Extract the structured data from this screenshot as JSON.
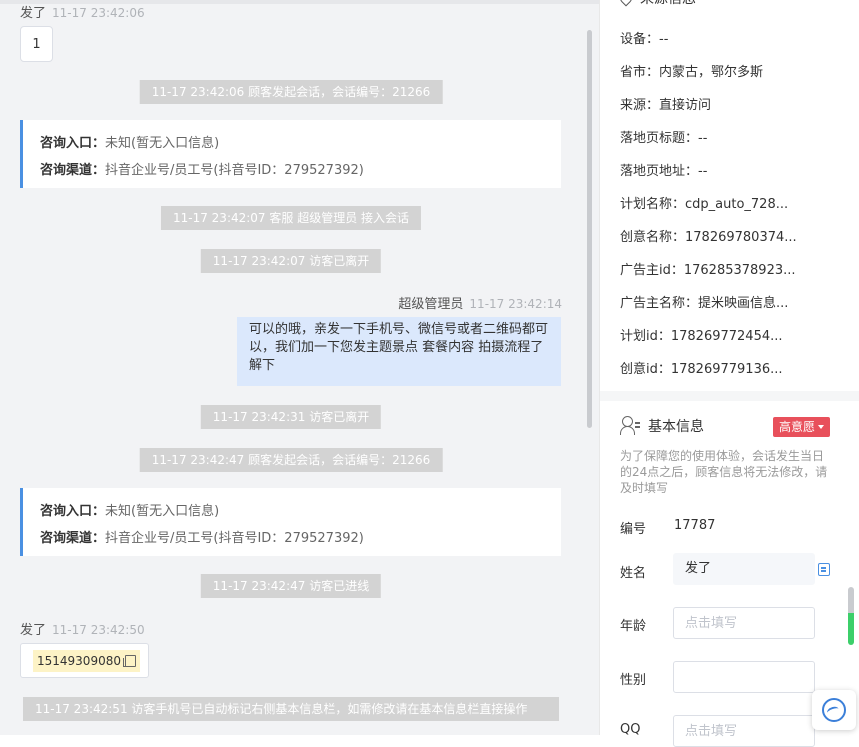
{
  "chat": {
    "top_sender": {
      "name": "发了",
      "time": "11-17 23:42:06"
    },
    "top_bubble": "1",
    "sys1": "11-17 23:42:06 顾客发起会话，会话编号：21266",
    "card1": {
      "entry_label": "咨询入口：",
      "entry_value": "未知(暂无入口信息)",
      "channel_label": "咨询渠道：",
      "channel_value": "抖音企业号/员工号(抖音号ID：279527392)"
    },
    "sys2": "11-17 23:42:07 客服 超级管理员 接入会话",
    "sys3": "11-17 23:42:07 访客已离开",
    "agent_sender": {
      "name": "超级管理员",
      "time": "11-17 23:42:14"
    },
    "agent_message": "可以的哦，亲发一下手机号、微信号或者二维码都可以，我们加一下您发主题景点 套餐内容 拍摄流程了解下",
    "sys4": "11-17 23:42:31 访客已离开",
    "sys5": "11-17 23:42:47 顾客发起会话，会话编号：21266",
    "card2": {
      "entry_label": "咨询入口：",
      "entry_value": "未知(暂无入口信息)",
      "channel_label": "咨询渠道：",
      "channel_value": "抖音企业号/员工号(抖音号ID：279527392)"
    },
    "sys6": "11-17 23:42:47 访客已进线",
    "visitor_sender": {
      "name": "发了",
      "time": "11-17 23:42:50"
    },
    "phone": "15149309080",
    "sys7": "11-17 23:42:51 访客手机号已自动标记右侧基本信息栏，如需修改请在基本信息栏直接操作"
  },
  "source": {
    "title": "来源信息",
    "rows": [
      "设备：--",
      "省市：内蒙古，鄂尔多斯",
      "来源：直接访问",
      "落地页标题：--",
      "落地页地址：--",
      "计划名称：cdp_auto_728...",
      "创意名称：178269780374...",
      "广告主id：176285378923...",
      "广告主名称：提米映画信息...",
      "计划id：178269772454...",
      "创意id：178269779136..."
    ]
  },
  "basic": {
    "title": "基本信息",
    "intent": "高意愿",
    "notice": "为了保障您的使用体验，会话发生当日的24点之后，顾客信息将无法修改，请及时填写",
    "id_label": "编号",
    "id_value": "17787",
    "name_label": "姓名",
    "name_value": "发了",
    "age_label": "年龄",
    "age_placeholder": "点击填写",
    "gender_label": "性别",
    "qq_label": "QQ",
    "qq_placeholder": "点击填写"
  },
  "colors": {
    "accent": "#4a90e2",
    "intent_badge": "#e8505b",
    "agent_bubble": "#dbe8fc",
    "system_pill": "#d3d3d3"
  }
}
